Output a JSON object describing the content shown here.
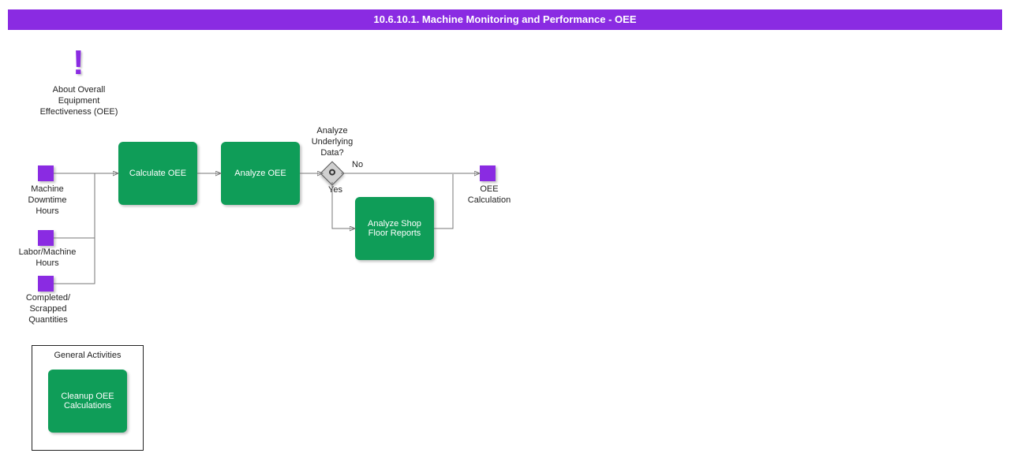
{
  "colors": {
    "header_bg": "#8a2be2",
    "activity_bg": "#0f9d58",
    "input_bg": "#8a2be2"
  },
  "header": {
    "title": "10.6.10.1. Machine Monitoring and Performance - OEE"
  },
  "info": {
    "icon": "exclamation-icon",
    "label": "About Overall\nEquipment\nEffectiveness (OEE)"
  },
  "inputs": [
    {
      "id": "machine-downtime",
      "label": "Machine\nDowntime\nHours"
    },
    {
      "id": "labor-machine-hours",
      "label": "Labor/Machine\nHours"
    },
    {
      "id": "completed-scrapped",
      "label": "Completed/\nScrapped\nQuantities"
    }
  ],
  "activities": {
    "calc_oee": "Calculate OEE",
    "analyze_oee": "Analyze OEE",
    "analyze_reports": "Analyze Shop\nFloor Reports"
  },
  "gateway": {
    "label": "Analyze\nUnderlying\nData?",
    "yes_label": "Yes",
    "no_label": "No"
  },
  "output": {
    "label": "OEE\nCalculation"
  },
  "general_activities": {
    "title": "General Activities",
    "cleanup": "Cleanup OEE\nCalculations"
  }
}
